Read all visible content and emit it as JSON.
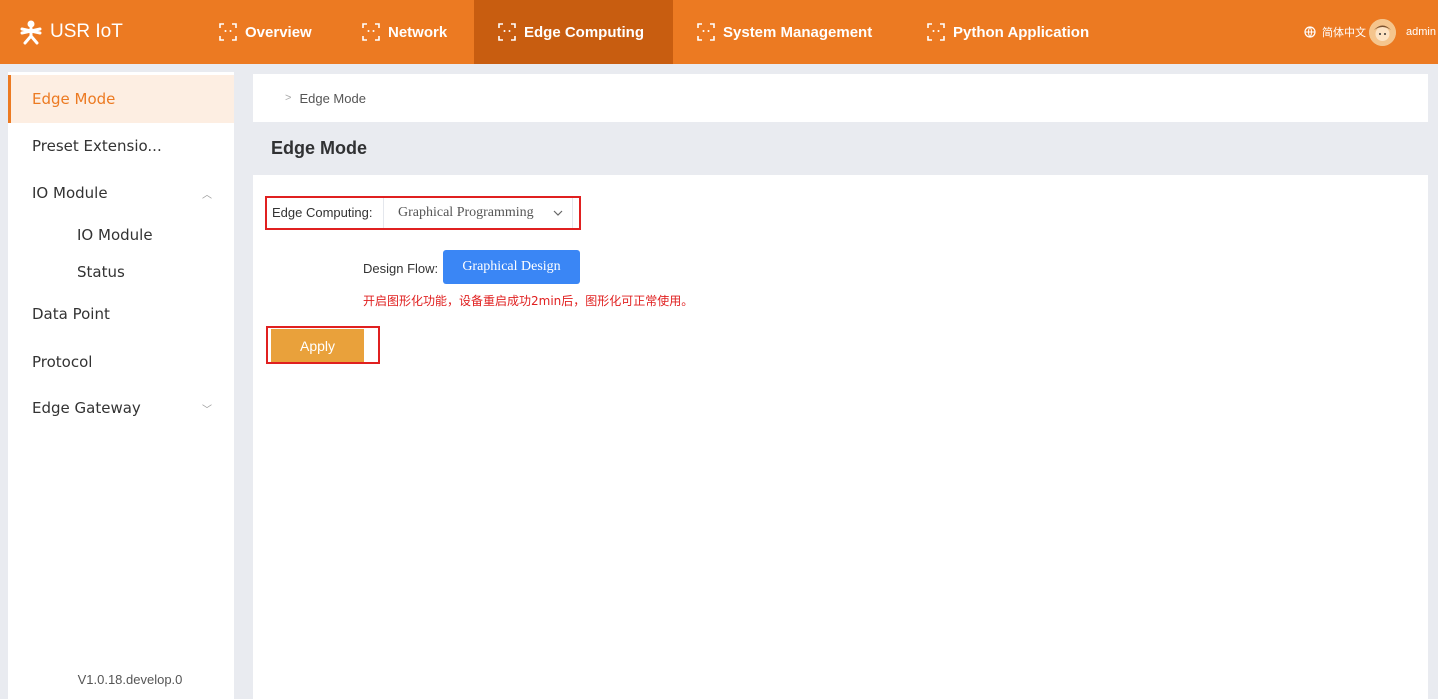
{
  "app": {
    "logo_text": "USR IoT"
  },
  "nav": {
    "items": [
      {
        "label": "Overview"
      },
      {
        "label": "Network"
      },
      {
        "label": "Edge Computing"
      },
      {
        "label": "System Management"
      },
      {
        "label": "Python Application"
      }
    ],
    "language": "简体中文",
    "user": "admin"
  },
  "sidebar": {
    "items": [
      {
        "label": "Edge Mode"
      },
      {
        "label": "Preset Extensio..."
      },
      {
        "label": "IO Module"
      },
      {
        "label": "IO Module"
      },
      {
        "label": "Status"
      },
      {
        "label": "Data Point"
      },
      {
        "label": "Protocol"
      },
      {
        "label": "Edge Gateway"
      }
    ],
    "version": "V1.0.18.develop.0"
  },
  "breadcrumb": {
    "current": "Edge Mode"
  },
  "page": {
    "title": "Edge Mode",
    "edge_computing_label": "Edge Computing:",
    "edge_computing_value": "Graphical Programming",
    "design_flow_label": "Design Flow:",
    "design_button": "Graphical Design",
    "notice": "开启图形化功能，设备重启成功2min后，图形化可正常使用。",
    "apply_button": "Apply"
  },
  "colors": {
    "brand": "#ec7a22",
    "nav_active": "#c85d10",
    "primary_button": "#3a86f5",
    "apply_button": "#e9a13b",
    "highlight": "#e02020"
  },
  "icons": {
    "logo": "usr-logo-icon",
    "nav": "scan-frame-icon",
    "language": "globe-icon",
    "select": "chevron-down-icon"
  }
}
